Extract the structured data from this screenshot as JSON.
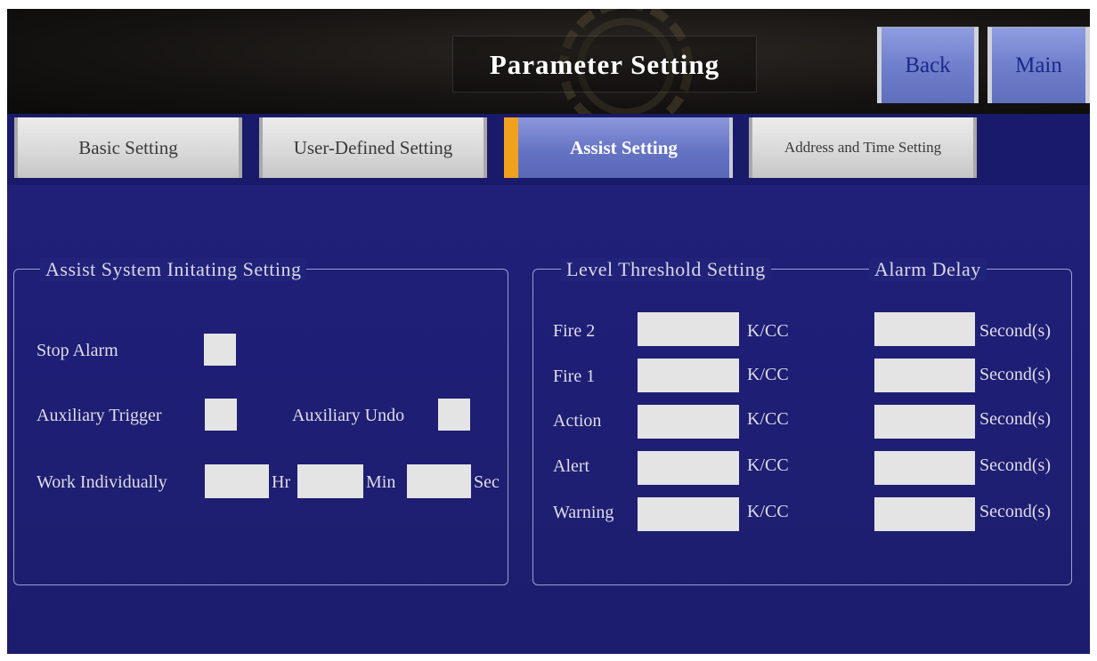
{
  "header": {
    "title": "Parameter Setting",
    "back_label": "Back",
    "main_label": "Main"
  },
  "tabs": [
    {
      "label": "Basic Setting",
      "active": false
    },
    {
      "label": "User-Defined Setting",
      "active": false
    },
    {
      "label": "Assist Setting",
      "active": true
    },
    {
      "label": "Address and Time Setting",
      "active": false
    }
  ],
  "assist_panel": {
    "legend": "Assist System Initating Setting",
    "stop_alarm_label": "Stop Alarm",
    "auxiliary_trigger_label": "Auxiliary Trigger",
    "auxiliary_undo_label": "Auxiliary Undo",
    "work_individually_label": "Work Individually",
    "hr_label": "Hr",
    "min_label": "Min",
    "sec_label": "Sec",
    "work_individually_values": {
      "hr": "",
      "min": "",
      "sec": ""
    }
  },
  "threshold_panel": {
    "legend_threshold": "Level Threshold Setting",
    "legend_delay": "Alarm Delay",
    "rows": [
      {
        "label": "Fire 2",
        "unit": "K/CC",
        "threshold": "",
        "delay_unit": "Second(s)",
        "delay": ""
      },
      {
        "label": "Fire 1",
        "unit": "K/CC",
        "threshold": "",
        "delay_unit": "Second(s)",
        "delay": ""
      },
      {
        "label": "Action",
        "unit": "K/CC",
        "threshold": "",
        "delay_unit": "Second(s)",
        "delay": ""
      },
      {
        "label": "Alert",
        "unit": "K/CC",
        "threshold": "",
        "delay_unit": "Second(s)",
        "delay": ""
      },
      {
        "label": "Warning",
        "unit": "K/CC",
        "threshold": "",
        "delay_unit": "Second(s)",
        "delay": ""
      }
    ]
  },
  "colors": {
    "background": "#1f1f78",
    "header": "#151311",
    "tab_active": "#6f7fcc",
    "tab_inactive": "#d9d9d9",
    "active_marker": "#f0a21e",
    "input_fill": "#e4e4e4"
  }
}
